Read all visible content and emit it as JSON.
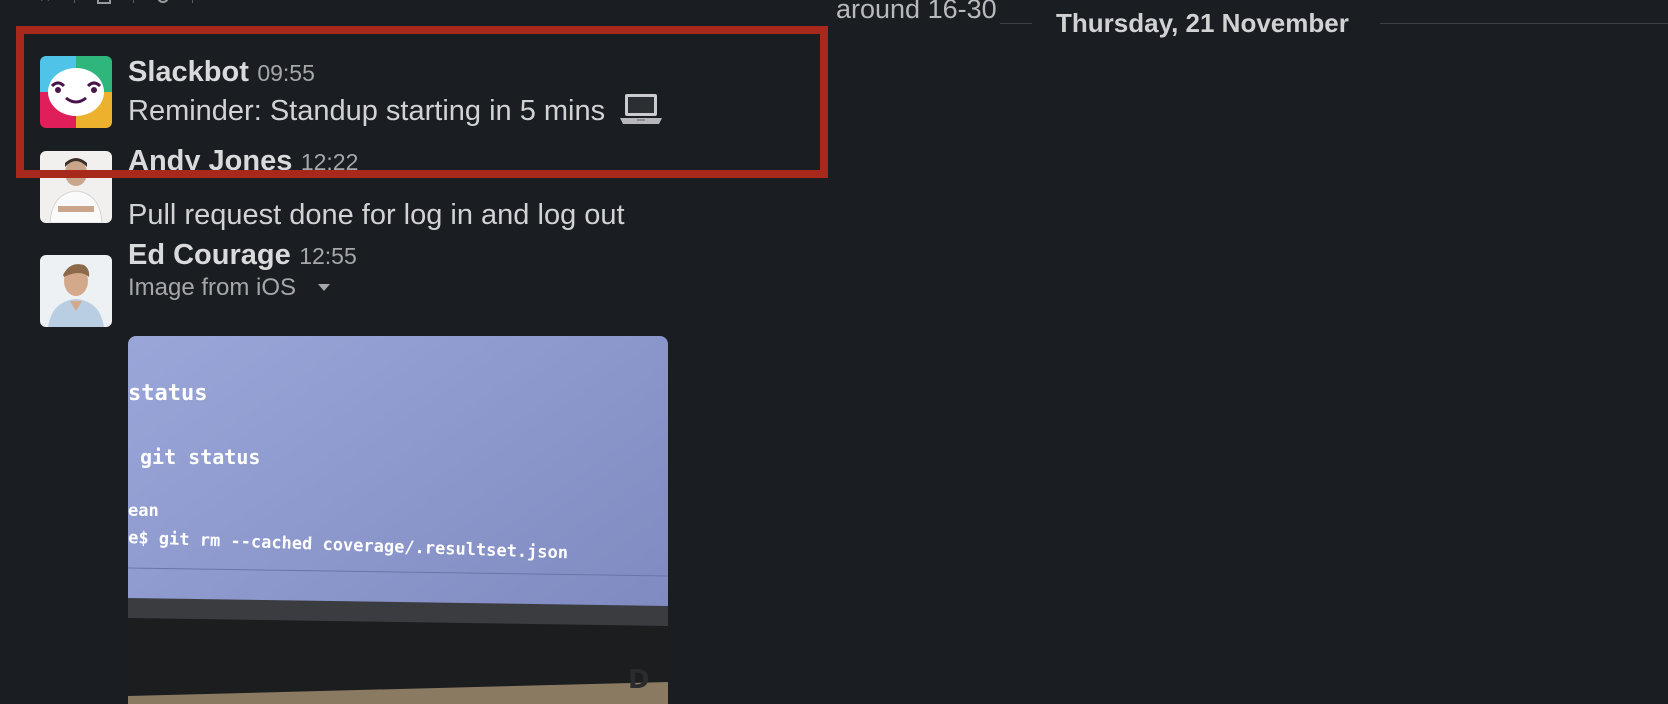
{
  "header": {
    "partial_text": "around 16-30"
  },
  "date_divider": {
    "label": "Thursday, 21 November"
  },
  "messages": [
    {
      "sender": "Slackbot",
      "time": "09:55",
      "text": "Reminder: Standup starting in 5 mins",
      "emoji": "laptop-emoji"
    },
    {
      "sender": "Andy Jones",
      "time": "12:22",
      "text": "Pull request done for log in and log out"
    },
    {
      "sender": "Ed Courage",
      "time": "12:55",
      "attachment_title": "Image from iOS",
      "image_lines": [
        "status",
        "git status",
        "ean",
        "e$ git rm --cached coverage/.resultset.json"
      ]
    }
  ],
  "colors": {
    "background": "#1a1d21",
    "highlight": "#a8291b",
    "text": "#d1d2d3",
    "muted": "#a6a7a9"
  }
}
